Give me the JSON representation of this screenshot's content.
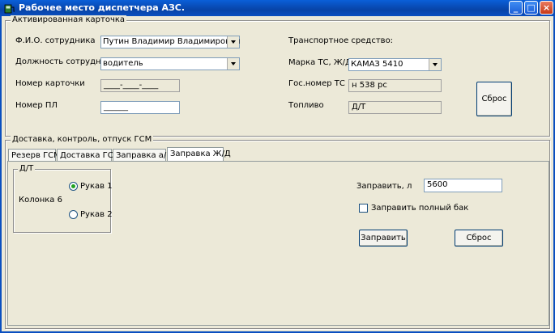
{
  "window": {
    "title": "Рабочее место диспетчера АЗС.",
    "minimize": "_",
    "maximize": "□",
    "close": "×"
  },
  "card": {
    "title": "Активированная карточка",
    "employee_name_label": "Ф.И.О. сотрудника",
    "employee_name_value": "Путин Владимир Владимирович",
    "position_label": "Должность сотрудника",
    "position_value": "водитель",
    "card_number_label": "Номер карточки",
    "card_number_value": "____-____-____",
    "pl_number_label": "Номер ПЛ",
    "pl_number_value": "______",
    "vehicle_header": "Транспортное средство:",
    "vehicle_brand_label": "Марка ТС, Ж/Д",
    "vehicle_brand_value": "КАМАЗ 5410",
    "plate_label": "Гос.номер ТС",
    "plate_value": "н 538 рс",
    "fuel_label": "Топливо",
    "fuel_value": "Д/Т",
    "reset_label": "Сброс"
  },
  "delivery": {
    "title": "Доставка, контроль, отпуск ГСМ",
    "tabs": [
      {
        "label": "Резерв ГСМ"
      },
      {
        "label": "Доставка ГСМ"
      },
      {
        "label": "Заправка а/м"
      },
      {
        "label": "Заправка Ж/Д"
      }
    ],
    "active_tab": "Заправка Ж/Д",
    "fuel_group_title": "Д/Т",
    "column_label": "Колонка 6",
    "hose1_label": "Рукав 1",
    "hose2_label": "Рукав 2",
    "hose1_selected": true,
    "refuel_label": "Заправить, л",
    "refuel_value": "5600",
    "full_tank_label": "Заправить полный бак",
    "full_tank_checked": false,
    "refuel_button": "Заправить",
    "reset_button": "Сброс"
  },
  "colors": {
    "titlebar": "#0a4fc0",
    "face": "#ece9d8"
  }
}
